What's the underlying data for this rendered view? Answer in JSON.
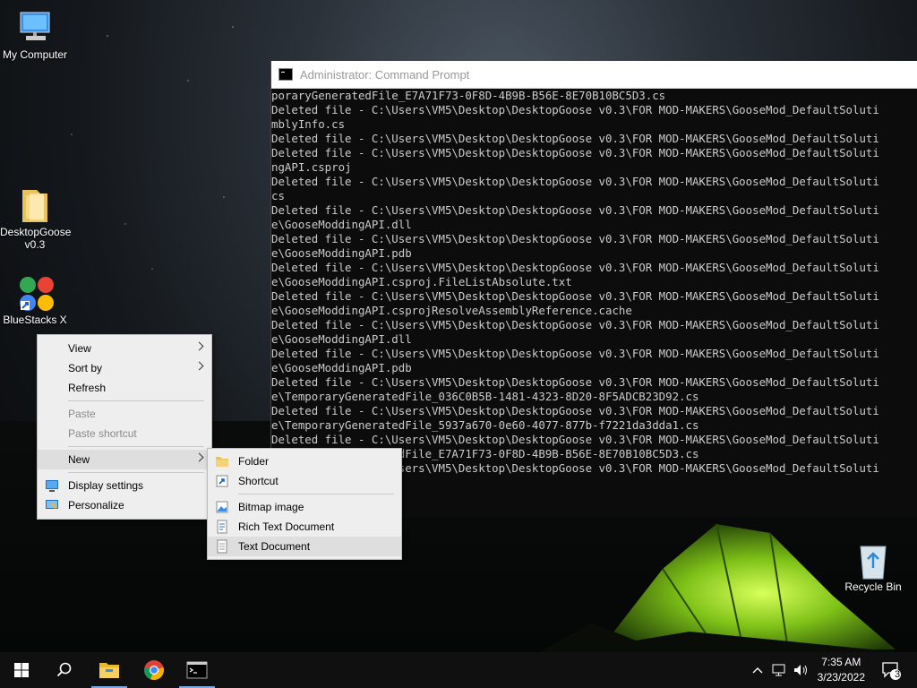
{
  "desktop": {
    "icons": {
      "my_computer": "My Computer",
      "desktop_goose": "DesktopGoose v0.3",
      "bluestacks": "BlueStacks X",
      "recycle_bin": "Recycle Bin"
    }
  },
  "cmd": {
    "title": "Administrator: Command Prompt",
    "lines": [
      "poraryGeneratedFile_E7A71F73-0F8D-4B9B-B56E-8E70B10BC5D3.cs",
      "Deleted file - C:\\Users\\VM5\\Desktop\\DesktopGoose v0.3\\FOR MOD-MAKERS\\GooseMod_DefaultSoluti",
      "mblyInfo.cs",
      "Deleted file - C:\\Users\\VM5\\Desktop\\DesktopGoose v0.3\\FOR MOD-MAKERS\\GooseMod_DefaultSoluti",
      "Deleted file - C:\\Users\\VM5\\Desktop\\DesktopGoose v0.3\\FOR MOD-MAKERS\\GooseMod_DefaultSoluti",
      "ngAPI.csproj",
      "Deleted file - C:\\Users\\VM5\\Desktop\\DesktopGoose v0.3\\FOR MOD-MAKERS\\GooseMod_DefaultSoluti",
      "cs",
      "Deleted file - C:\\Users\\VM5\\Desktop\\DesktopGoose v0.3\\FOR MOD-MAKERS\\GooseMod_DefaultSoluti",
      "e\\GooseModdingAPI.dll",
      "Deleted file - C:\\Users\\VM5\\Desktop\\DesktopGoose v0.3\\FOR MOD-MAKERS\\GooseMod_DefaultSoluti",
      "e\\GooseModdingAPI.pdb",
      "Deleted file - C:\\Users\\VM5\\Desktop\\DesktopGoose v0.3\\FOR MOD-MAKERS\\GooseMod_DefaultSoluti",
      "e\\GooseModdingAPI.csproj.FileListAbsolute.txt",
      "Deleted file - C:\\Users\\VM5\\Desktop\\DesktopGoose v0.3\\FOR MOD-MAKERS\\GooseMod_DefaultSoluti",
      "e\\GooseModdingAPI.csprojResolveAssemblyReference.cache",
      "Deleted file - C:\\Users\\VM5\\Desktop\\DesktopGoose v0.3\\FOR MOD-MAKERS\\GooseMod_DefaultSoluti",
      "e\\GooseModdingAPI.dll",
      "Deleted file - C:\\Users\\VM5\\Desktop\\DesktopGoose v0.3\\FOR MOD-MAKERS\\GooseMod_DefaultSoluti",
      "e\\GooseModdingAPI.pdb",
      "Deleted file - C:\\Users\\VM5\\Desktop\\DesktopGoose v0.3\\FOR MOD-MAKERS\\GooseMod_DefaultSoluti",
      "e\\TemporaryGeneratedFile_036C0B5B-1481-4323-8D20-8F5ADCB23D92.cs",
      "Deleted file - C:\\Users\\VM5\\Desktop\\DesktopGoose v0.3\\FOR MOD-MAKERS\\GooseMod_DefaultSoluti",
      "e\\TemporaryGeneratedFile_5937a670-0e60-4077-877b-f7221da3dda1.cs",
      "Deleted file - C:\\Users\\VM5\\Desktop\\DesktopGoose v0.3\\FOR MOD-MAKERS\\GooseMod_DefaultSoluti",
      "e\\TemporaryGeneratedFile_E7A71F73-0F8D-4B9B-B56E-8E70B10BC5D3.cs",
      "Deleted file - C:\\Users\\VM5\\Desktop\\DesktopGoose v0.3\\FOR MOD-MAKERS\\GooseMod_DefaultSoluti"
    ]
  },
  "context_menu": {
    "view": "View",
    "sort_by": "Sort by",
    "refresh": "Refresh",
    "paste": "Paste",
    "paste_shortcut": "Paste shortcut",
    "new": "New",
    "display_settings": "Display settings",
    "personalize": "Personalize"
  },
  "new_submenu": {
    "folder": "Folder",
    "shortcut": "Shortcut",
    "bitmap_image": "Bitmap image",
    "rich_text_document": "Rich Text Document",
    "text_document": "Text Document"
  },
  "taskbar": {
    "time": "7:35 AM",
    "date": "3/23/2022",
    "notification_count": "3"
  },
  "icons": {
    "start": "windows-start-icon",
    "search": "search-icon",
    "explorer": "file-explorer-icon",
    "chrome": "chrome-icon",
    "cmd": "command-prompt-icon"
  }
}
